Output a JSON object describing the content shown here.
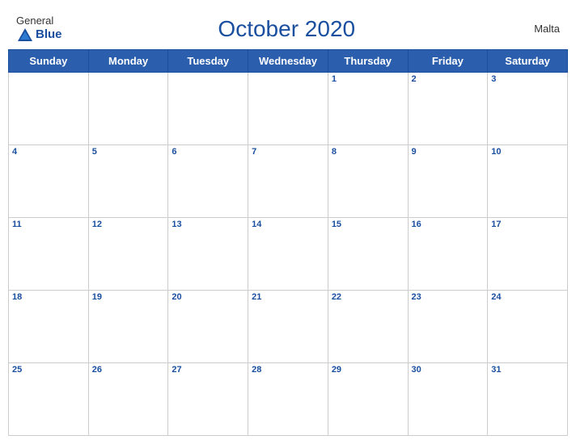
{
  "header": {
    "logo_general": "General",
    "logo_blue": "Blue",
    "month_title": "October 2020",
    "country": "Malta"
  },
  "days_of_week": [
    "Sunday",
    "Monday",
    "Tuesday",
    "Wednesday",
    "Thursday",
    "Friday",
    "Saturday"
  ],
  "weeks": [
    [
      null,
      null,
      null,
      null,
      1,
      2,
      3
    ],
    [
      4,
      5,
      6,
      7,
      8,
      9,
      10
    ],
    [
      11,
      12,
      13,
      14,
      15,
      16,
      17
    ],
    [
      18,
      19,
      20,
      21,
      22,
      23,
      24
    ],
    [
      25,
      26,
      27,
      28,
      29,
      30,
      31
    ]
  ]
}
